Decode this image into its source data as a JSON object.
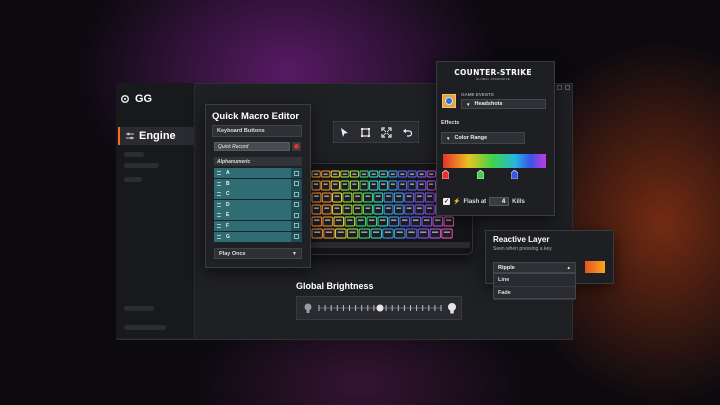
{
  "app": {
    "brand": "GG",
    "sidebar_active": "Engine"
  },
  "toolbar": {
    "tools": [
      "cursor-icon",
      "crop-icon",
      "expand-icon",
      "undo-icon"
    ]
  },
  "macro_editor": {
    "title": "Quick Macro Editor",
    "keyboard_buttons": "Keyboard Buttons",
    "quick_record": "Quick Record",
    "section": "Alphanumeric",
    "keys": [
      "A",
      "B",
      "C",
      "D",
      "E",
      "F",
      "G"
    ],
    "play_mode": "Play Once"
  },
  "brightness": {
    "title": "Global Brightness",
    "level": 0.5
  },
  "game_panel": {
    "logo": "COUNTER-STRIKE",
    "logo_sub": "GLOBAL OFFENSIVE",
    "events_label": "GAME EVENTS",
    "event": "Headshots",
    "effects_label": "Effects",
    "effect": "Color Range",
    "gradient_stops": [
      "#e8312e",
      "#3fd34a",
      "#3b52e6"
    ],
    "flash_label": "Flash at",
    "flash_count": "4",
    "flash_unit": "Kills"
  },
  "reactive": {
    "title": "Reactive Layer",
    "description": "Seen when pressing a key.",
    "selected": "Ripple",
    "options": [
      "Line",
      "Fade"
    ],
    "swatch_colors": [
      "#e8531f",
      "#f6a722"
    ]
  }
}
